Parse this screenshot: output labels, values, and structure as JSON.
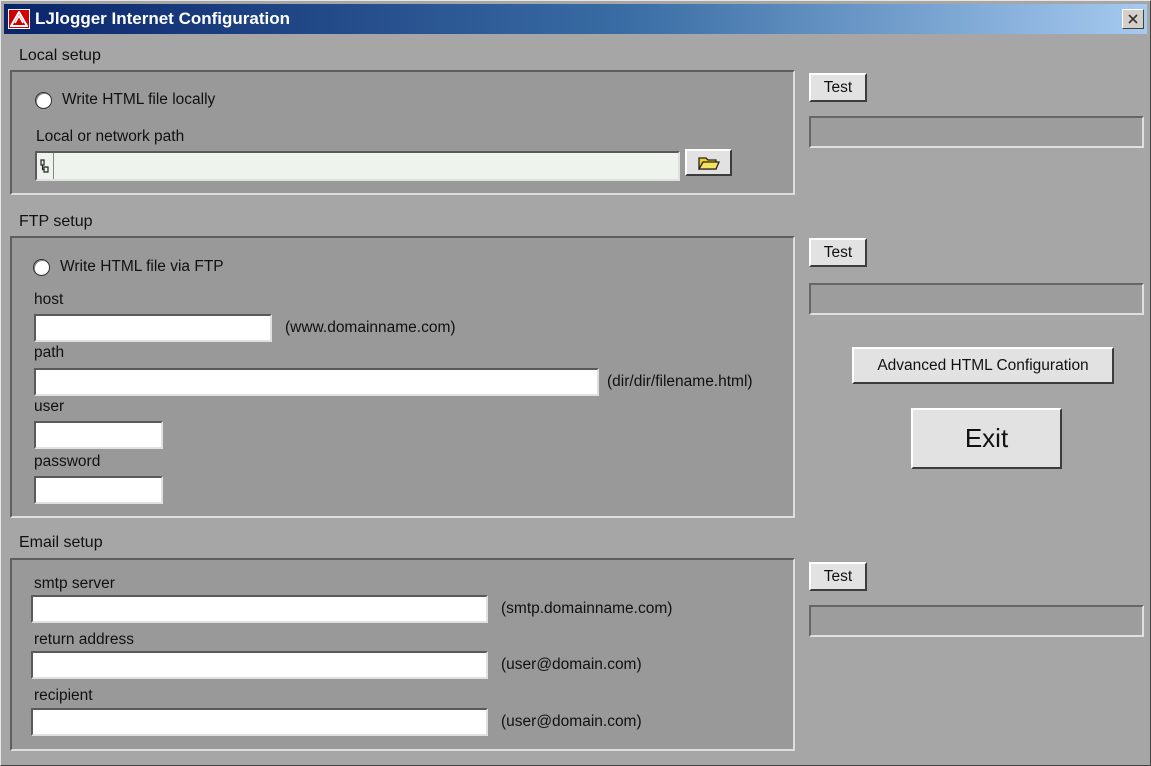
{
  "window": {
    "title": "LJlogger Internet Configuration"
  },
  "local": {
    "section_title": "Local setup",
    "radio_label": "Write HTML file locally",
    "path_label": "Local or network path",
    "path_value": "",
    "test_label": "Test",
    "status_text": ""
  },
  "ftp": {
    "section_title": "FTP setup",
    "radio_label": "Write HTML file via FTP",
    "host_label": "host",
    "host_hint": "(www.domainname.com)",
    "path_label": "path",
    "path_hint": "(dir/dir/filename.html)",
    "user_label": "user",
    "password_label": "password",
    "test_label": "Test",
    "status_text": ""
  },
  "email": {
    "section_title": "Email setup",
    "smtp_label": "smtp server",
    "smtp_hint": "(smtp.domainname.com)",
    "return_label": "return address",
    "return_hint": "(user@domain.com)",
    "recipient_label": "recipient",
    "recipient_hint": "(user@domain.com)",
    "test_label": "Test",
    "status_text": ""
  },
  "actions": {
    "advanced_label": "Advanced HTML Configuration",
    "exit_label": "Exit"
  },
  "colors": {
    "titlebar_start": "#0a246a",
    "titlebar_end": "#a6caf0",
    "app_icon": "#d00000",
    "folder_icon": "#f2d020"
  },
  "icons": {
    "app": "app-logo-icon",
    "close": "close-icon",
    "folder": "folder-open-icon",
    "drive": "drive-icon"
  }
}
